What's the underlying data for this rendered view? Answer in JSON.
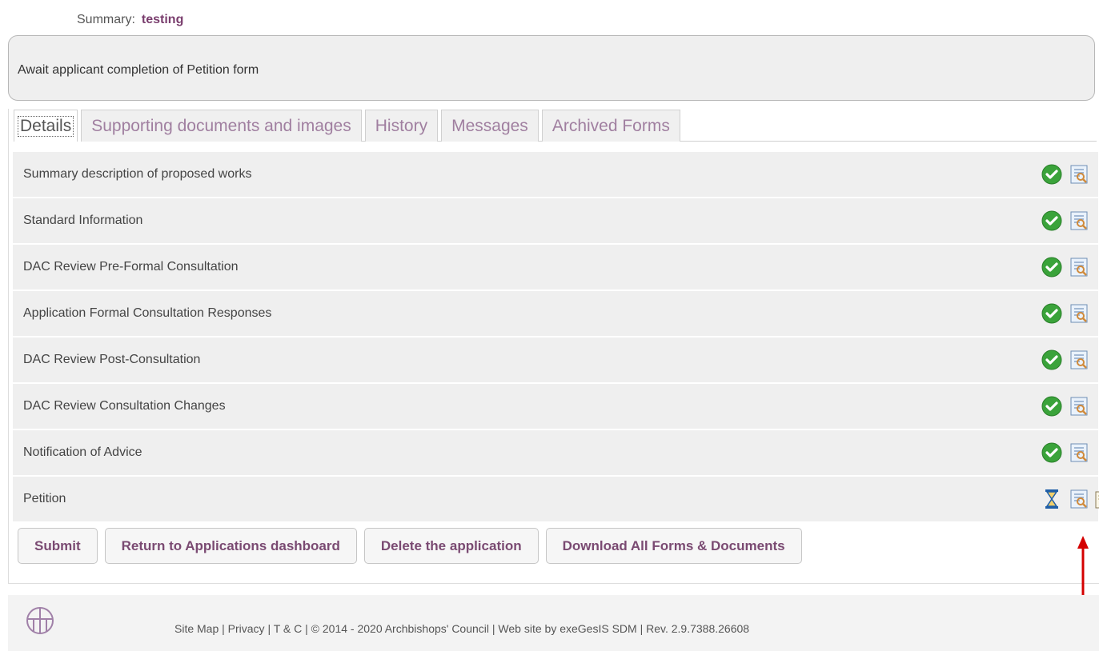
{
  "summary": {
    "label": "Summary:",
    "value": "testing"
  },
  "status_message": "Await applicant completion of Petition form",
  "tabs": [
    {
      "label": "Details",
      "active": true
    },
    {
      "label": "Supporting documents and images",
      "active": false
    },
    {
      "label": "History",
      "active": false
    },
    {
      "label": "Messages",
      "active": false
    },
    {
      "label": "Archived Forms",
      "active": false
    }
  ],
  "forms": [
    {
      "label": "Summary description of proposed works",
      "status": "complete"
    },
    {
      "label": "Standard Information",
      "status": "complete"
    },
    {
      "label": "DAC Review Pre-Formal Consultation",
      "status": "complete"
    },
    {
      "label": "Application Formal Consultation Responses",
      "status": "complete"
    },
    {
      "label": "DAC Review Post-Consultation",
      "status": "complete"
    },
    {
      "label": "DAC Review Consultation Changes",
      "status": "complete"
    },
    {
      "label": "Notification of Advice",
      "status": "complete"
    },
    {
      "label": "Petition",
      "status": "pending"
    }
  ],
  "buttons": {
    "submit": "Submit",
    "return": "Return to Applications dashboard",
    "delete": "Delete the application",
    "download": "Download All Forms & Documents"
  },
  "footer": {
    "text": "Site Map | Privacy | T & C | © 2014 - 2020 Archbishops' Council | Web site by exeGesIS SDM | Rev. 2.9.7388.26608"
  },
  "colors": {
    "accent": "#7a4a72",
    "check_green": "#3aa33a",
    "arrow_red": "#d40000",
    "row_bg": "#efefef"
  }
}
